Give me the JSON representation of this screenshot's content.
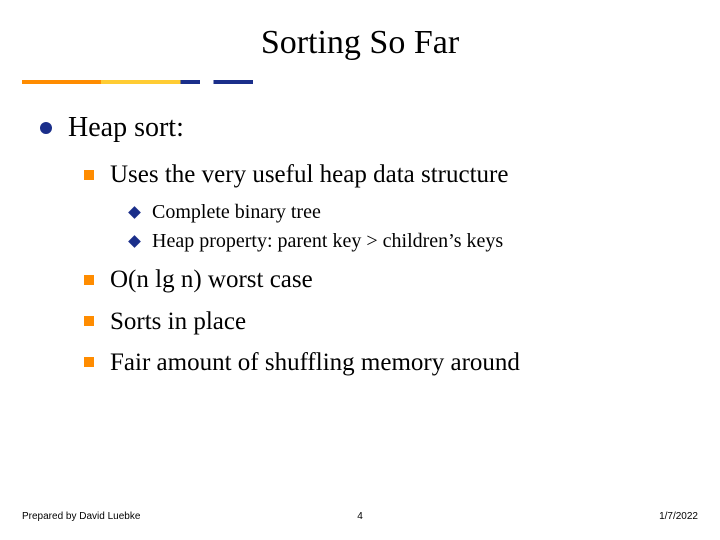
{
  "title": "Sorting So Far",
  "lvl1": {
    "text": "Heap sort:"
  },
  "lvl2": [
    {
      "text": "Uses the very useful heap data structure"
    },
    {
      "text": "O(n lg n) worst case"
    },
    {
      "text": "Sorts in place"
    },
    {
      "text": "Fair amount of shuffling memory around"
    }
  ],
  "lvl3": [
    {
      "text": "Complete binary tree"
    },
    {
      "text": "Heap property: parent key > children’s keys"
    }
  ],
  "footer": {
    "left": "Prepared by David Luebke",
    "center": "4",
    "right": "1/7/2022"
  }
}
